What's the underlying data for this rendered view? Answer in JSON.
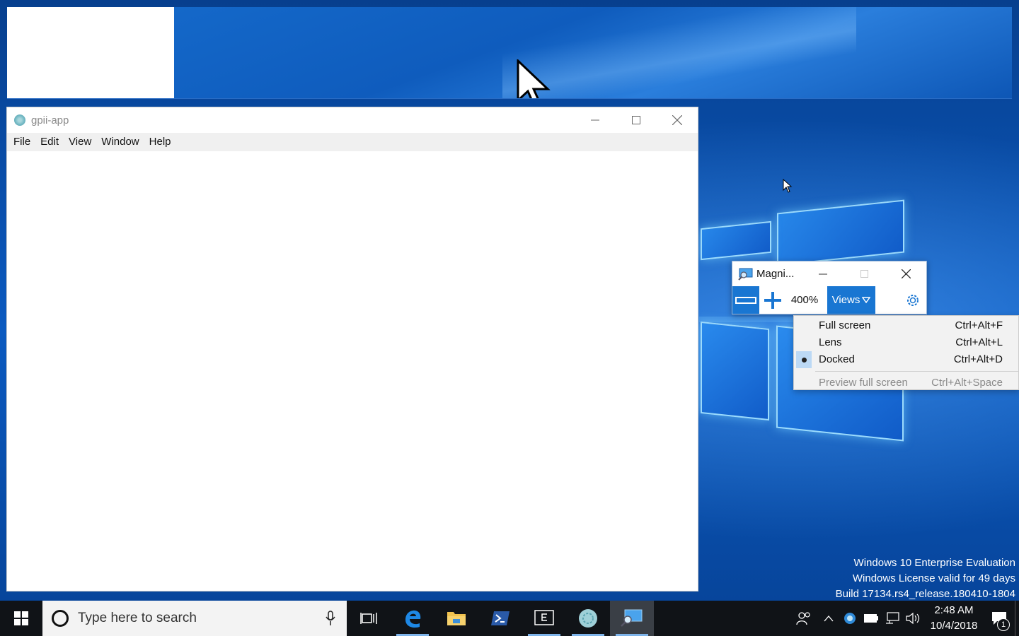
{
  "gpii_window": {
    "title": "gpii-app",
    "menu": [
      "File",
      "Edit",
      "View",
      "Window",
      "Help"
    ]
  },
  "magnifier": {
    "title": "Magni...",
    "zoom_level": "400%",
    "views_label": "Views",
    "menu": {
      "items": [
        {
          "label": "Full screen",
          "shortcut": "Ctrl+Alt+F",
          "selected": false
        },
        {
          "label": "Lens",
          "shortcut": "Ctrl+Alt+L",
          "selected": false
        },
        {
          "label": "Docked",
          "shortcut": "Ctrl+Alt+D",
          "selected": true
        }
      ],
      "preview": {
        "label": "Preview full screen",
        "shortcut": "Ctrl+Alt+Space",
        "disabled": true
      }
    }
  },
  "watermark": {
    "line1": "Windows 10 Enterprise Evaluation",
    "line2": "Windows License valid for 49 days",
    "line3": "Build 17134.rs4_release.180410-1804"
  },
  "taskbar": {
    "search_placeholder": "Type here to search",
    "apps": [
      "task-view-icon",
      "edge-icon",
      "file-explorer-icon",
      "powershell-icon",
      "editor-icon",
      "gpii-app-icon",
      "magnifier-icon"
    ],
    "clock_time": "2:48 AM",
    "clock_date": "10/4/2018",
    "notification_count": "1"
  },
  "colors": {
    "accent": "#1976d2",
    "taskbar": "#101317",
    "menu_bg": "#f2f2f2"
  }
}
